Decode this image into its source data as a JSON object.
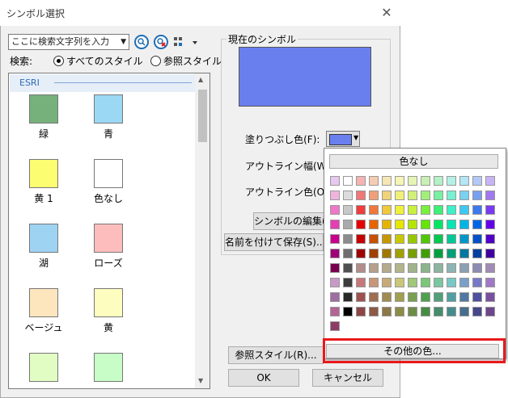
{
  "dialog": {
    "title": "シンボル選択",
    "close_glyph": "✕"
  },
  "search": {
    "placeholder": "ここに検索文字列を入力",
    "label": "検索:",
    "opt_all": "すべてのスタイル",
    "opt_ref": "参照スタイル"
  },
  "list": {
    "group": "ESRI",
    "items": [
      {
        "label": "緑",
        "color": "#76b07a"
      },
      {
        "label": "青",
        "color": "#9bd8f4"
      },
      {
        "label": "黄 1",
        "color": "#fdfd72"
      },
      {
        "label": "色なし",
        "color": "#ffffff"
      },
      {
        "label": "湖",
        "color": "#9ed3f2"
      },
      {
        "label": "ローズ",
        "color": "#fdbdbd"
      },
      {
        "label": "ベージュ",
        "color": "#fde5be"
      },
      {
        "label": "黄",
        "color": "#fdfdc0"
      },
      {
        "label": "",
        "color": "#e2fdc4"
      },
      {
        "label": "",
        "color": "#c8fdc8"
      }
    ]
  },
  "current": {
    "group_label": "現在のシンボル",
    "preview_color": "#6a7fee"
  },
  "props": {
    "fill_label": "塗りつぶし色(F):",
    "outline_width_label": "アウトライン幅(W):",
    "outline_color_label": "アウトライン色(O):"
  },
  "buttons": {
    "edit": "シンボルの編集(E)...",
    "save": "名前を付けて保存(S)...",
    "ref": "参照スタイル(R)...",
    "ok": "OK",
    "cancel": "キャンセル"
  },
  "palette": {
    "no_color": "色なし",
    "more": "その他の色...",
    "rows": [
      [
        "#e6c8f0",
        "#ffffff",
        "#f5b4b4",
        "#f5cdb4",
        "#f5e6b4",
        "#f5f5b4",
        "#e6f5b4",
        "#c8f0b4",
        "#b4f0c8",
        "#b4f0e6",
        "#b4e6f5",
        "#b4c8f5",
        "#c8b4f5"
      ],
      [
        "#f0b4dc",
        "#dcdcdc",
        "#f07878",
        "#f0a078",
        "#f0d278",
        "#f0f078",
        "#d2f078",
        "#a0f078",
        "#78f0a0",
        "#78f0d2",
        "#78d2f0",
        "#78a0f0",
        "#a078f0"
      ],
      [
        "#f078c8",
        "#c8c8c8",
        "#f03c3c",
        "#f0783c",
        "#f0c83c",
        "#f0f03c",
        "#c8f03c",
        "#78f03c",
        "#3cf078",
        "#3cf0c8",
        "#3cc8f0",
        "#3c78f0",
        "#783cf0"
      ],
      [
        "#e63cb4",
        "#aaaaaa",
        "#e60000",
        "#e66400",
        "#e6b400",
        "#e6e600",
        "#b4e600",
        "#64e600",
        "#00e664",
        "#00e6b4",
        "#00b4e6",
        "#0064e6",
        "#6400e6"
      ],
      [
        "#c8008c",
        "#8c8c8c",
        "#c80000",
        "#c85000",
        "#c89600",
        "#c8c800",
        "#96c800",
        "#50c800",
        "#00c850",
        "#00c896",
        "#0096c8",
        "#0050c8",
        "#5000c8"
      ],
      [
        "#a00078",
        "#6e6e6e",
        "#a00000",
        "#a04000",
        "#a07800",
        "#a0a000",
        "#78a000",
        "#40a000",
        "#00a040",
        "#00a078",
        "#0078a0",
        "#0040a0",
        "#4000a0"
      ],
      [
        "#780050",
        "#505050",
        "#b48c8c",
        "#b4a08c",
        "#b4aa8c",
        "#b4b48c",
        "#a0b48c",
        "#8cb48c",
        "#8cb4a0",
        "#8cb4b4",
        "#8ca0b4",
        "#8c8cb4",
        "#a08cb4"
      ],
      [
        "#c89ac8",
        "#3c3c3c",
        "#c87878",
        "#c89678",
        "#c8aa78",
        "#c8c878",
        "#a0c878",
        "#78c878",
        "#78c8a0",
        "#78c8c8",
        "#78a0c8",
        "#7878c8",
        "#a078c8"
      ],
      [
        "#a06ea0",
        "#282828",
        "#a05050",
        "#a06e50",
        "#a08c50",
        "#a0a050",
        "#78a050",
        "#50a050",
        "#50a078",
        "#50a0a0",
        "#5078a0",
        "#5050a0",
        "#7850a0"
      ],
      [
        "#b46496",
        "#000000",
        "#8c4646",
        "#8c5a46",
        "#8c7846",
        "#8c8c46",
        "#6e8c46",
        "#468c46",
        "#468c6e",
        "#468c8c",
        "#466e8c",
        "#46468c",
        "#6e468c"
      ],
      [
        "#8c3c64"
      ]
    ]
  }
}
